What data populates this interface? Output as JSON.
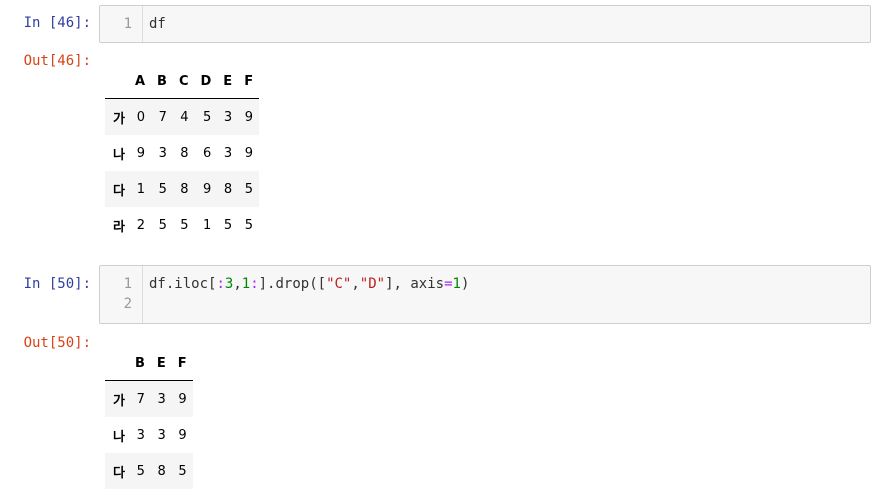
{
  "cells": [
    {
      "in_prompt": "In [46]:",
      "out_prompt": "Out[46]:",
      "line_numbers": [
        "1"
      ],
      "code_line": "df",
      "table": {
        "columns": [
          "A",
          "B",
          "C",
          "D",
          "E",
          "F"
        ],
        "rows": [
          {
            "index": "가",
            "values": [
              "0",
              "7",
              "4",
              "5",
              "3",
              "9"
            ]
          },
          {
            "index": "나",
            "values": [
              "9",
              "3",
              "8",
              "6",
              "3",
              "9"
            ]
          },
          {
            "index": "다",
            "values": [
              "1",
              "5",
              "8",
              "9",
              "8",
              "5"
            ]
          },
          {
            "index": "라",
            "values": [
              "2",
              "5",
              "5",
              "1",
              "5",
              "5"
            ]
          }
        ]
      }
    },
    {
      "in_prompt": "In [50]:",
      "out_prompt": "Out[50]:",
      "line_numbers": [
        "1",
        "2"
      ],
      "code_tokens": {
        "t1": "df.iloc[",
        "t2": ":",
        "t3": "3",
        "t4": ",",
        "t5": "1",
        "t6": ":",
        "t7": "].drop([",
        "t8": "\"C\"",
        "t9": ",",
        "t10": "\"D\"",
        "t11": "], axis",
        "t12": "=",
        "t13": "1",
        "t14": ")"
      },
      "table": {
        "columns": [
          "B",
          "E",
          "F"
        ],
        "rows": [
          {
            "index": "가",
            "values": [
              "7",
              "3",
              "9"
            ]
          },
          {
            "index": "나",
            "values": [
              "3",
              "3",
              "9"
            ]
          },
          {
            "index": "다",
            "values": [
              "5",
              "8",
              "5"
            ]
          }
        ]
      }
    }
  ]
}
